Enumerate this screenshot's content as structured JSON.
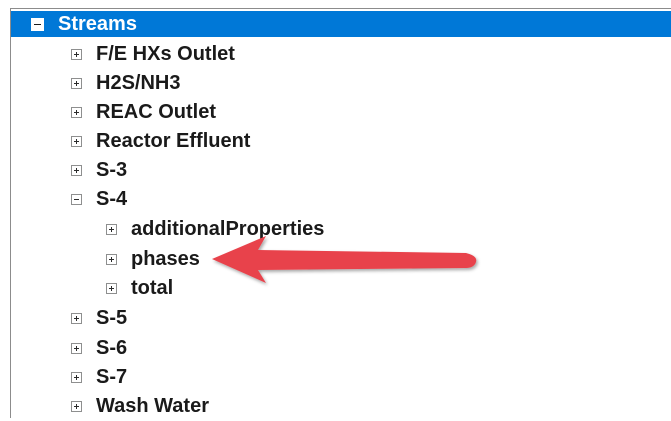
{
  "tree": {
    "root": {
      "label": "Streams",
      "expanded": true
    },
    "items": [
      {
        "label": "F/E HXs Outlet",
        "expanded": false
      },
      {
        "label": "H2S/NH3",
        "expanded": false
      },
      {
        "label": "REAC Outlet",
        "expanded": false
      },
      {
        "label": "Reactor Effluent",
        "expanded": false
      },
      {
        "label": "S-3",
        "expanded": false
      },
      {
        "label": "S-4",
        "expanded": true,
        "children": [
          {
            "label": "additionalProperties",
            "expanded": false
          },
          {
            "label": "phases",
            "expanded": false
          },
          {
            "label": "total",
            "expanded": false
          }
        ]
      },
      {
        "label": "S-5",
        "expanded": false
      },
      {
        "label": "S-6",
        "expanded": false
      },
      {
        "label": "S-7",
        "expanded": false
      },
      {
        "label": "Wash Water",
        "expanded": false
      }
    ]
  },
  "colors": {
    "selection": "#0078d7",
    "arrow": "#e8424b",
    "text": "#1a1a1a"
  },
  "annotation": {
    "icon": "arrow-left-icon",
    "points_to": "phases"
  }
}
